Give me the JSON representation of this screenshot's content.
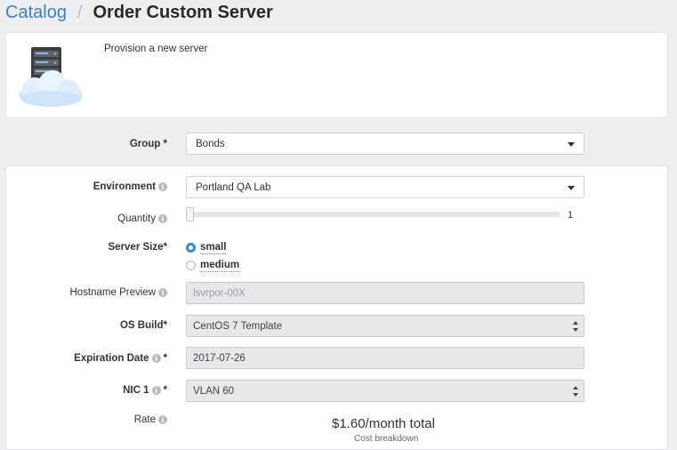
{
  "breadcrumb": {
    "catalog": "Catalog",
    "separator": "/",
    "current": "Order Custom Server"
  },
  "hero": {
    "icon": "server-cloud-icon",
    "description": "Provision a new server"
  },
  "form": {
    "group": {
      "label": "Group *",
      "value": "Bonds"
    },
    "environment": {
      "label": "Environment",
      "value": "Portland QA Lab"
    },
    "quantity": {
      "label": "Quantity",
      "value": "1"
    },
    "server_size": {
      "label": "Server Size*",
      "options": [
        "small",
        "medium"
      ],
      "selected": "small"
    },
    "hostname_preview": {
      "label": "Hostname Preview",
      "placeholder": "lsvrpor-00X"
    },
    "os_build": {
      "label": "OS Build*",
      "value": "CentOS 7 Template"
    },
    "expiration_date": {
      "label": "Expiration Date",
      "required": "*",
      "value": "2017-07-26"
    },
    "nic1": {
      "label": "NIC 1",
      "required": "*",
      "value": "VLAN 60"
    },
    "rate": {
      "label": "Rate",
      "value": "$1.60/month total",
      "sub": "Cost breakdown"
    }
  },
  "colors": {
    "accent": "#3d7fc1",
    "radio": "#3a86d6",
    "background": "#eeeff1"
  }
}
